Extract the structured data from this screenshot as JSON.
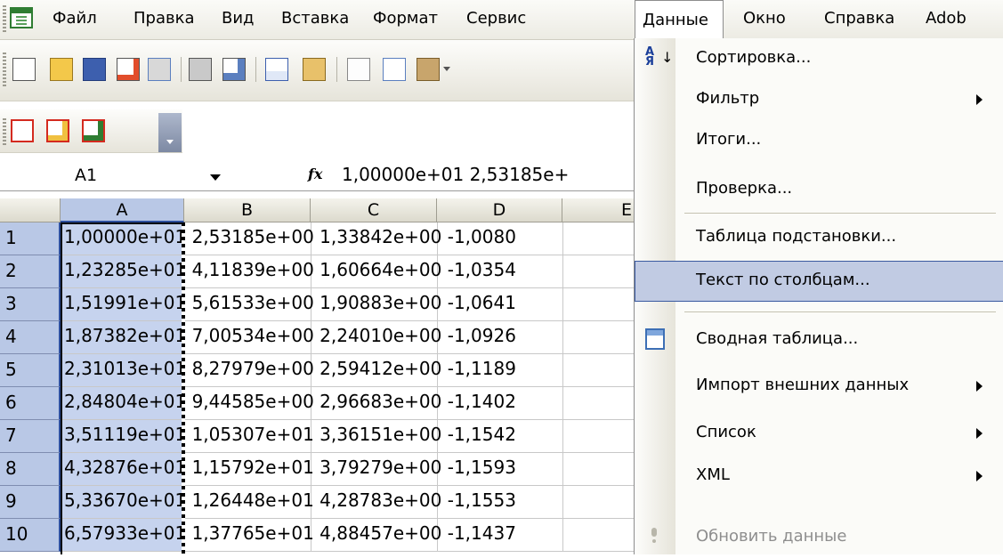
{
  "menubar": {
    "items": [
      {
        "label": "Файл"
      },
      {
        "label": "Правка"
      },
      {
        "label": "Вид"
      },
      {
        "label": "Вставка"
      },
      {
        "label": "Формат"
      },
      {
        "label": "Сервис"
      },
      {
        "label": "Данные"
      },
      {
        "label": "Окно"
      },
      {
        "label": "Справка"
      },
      {
        "label": "Adob"
      }
    ],
    "active_index": 6
  },
  "toolbar": {
    "icons": [
      "new-document-icon",
      "open-folder-icon",
      "save-icon",
      "permission-icon",
      "email-icon",
      "print-icon",
      "print-preview-icon",
      "spelling-icon",
      "research-icon",
      "cut-icon",
      "copy-icon",
      "paste-icon"
    ],
    "pdf_icons": [
      "convert-to-pdf-icon",
      "convert-and-email-pdf-icon",
      "convert-and-review-pdf-icon"
    ]
  },
  "formula_bar": {
    "name_box": "A1",
    "fx_label": "fx",
    "formula": "1,00000e+01  2,53185e+"
  },
  "sheet": {
    "columns": [
      "A",
      "B",
      "C",
      "D",
      "E"
    ],
    "rows": [
      {
        "num": "1",
        "text": "1,00000e+01  2,53185e+00  1,33842e+00 -1,0080"
      },
      {
        "num": "2",
        "text": "1,23285e+01  4,11839e+00  1,60664e+00 -1,0354"
      },
      {
        "num": "3",
        "text": "1,51991e+01  5,61533e+00  1,90883e+00 -1,0641"
      },
      {
        "num": "4",
        "text": "1,87382e+01  7,00534e+00  2,24010e+00 -1,0926"
      },
      {
        "num": "5",
        "text": "2,31013e+01  8,27979e+00  2,59412e+00 -1,1189"
      },
      {
        "num": "6",
        "text": "2,84804e+01  9,44585e+00  2,96683e+00 -1,1402"
      },
      {
        "num": "7",
        "text": "3,51119e+01  1,05307e+01  3,36151e+00 -1,1542"
      },
      {
        "num": "8",
        "text": "4,32876e+01  1,15792e+01  3,79279e+00 -1,1593"
      },
      {
        "num": "9",
        "text": "5,33670e+01  1,26448e+01  4,28783e+00 -1,1553"
      },
      {
        "num": "10",
        "text": "6,57933e+01  1,37765e+01  4,88457e+00 -1,1437"
      }
    ]
  },
  "data_menu": {
    "items": [
      {
        "label": "Сортировка...",
        "icon": "sort-ascending-icon",
        "submenu": false,
        "state": "normal"
      },
      {
        "label": "Фильтр",
        "submenu": true,
        "state": "normal"
      },
      {
        "label": "Итоги...",
        "submenu": false,
        "state": "normal"
      },
      {
        "label": "Проверка...",
        "submenu": false,
        "state": "normal"
      },
      {
        "label": "Таблица подстановки...",
        "submenu": false,
        "state": "normal"
      },
      {
        "label": "Текст по столбцам...",
        "submenu": false,
        "state": "highlighted"
      },
      {
        "label": "Сводная таблица...",
        "icon": "pivot-table-icon",
        "submenu": false,
        "state": "normal"
      },
      {
        "label": "Импорт внешних данных",
        "submenu": true,
        "state": "normal"
      },
      {
        "label": "Список",
        "submenu": true,
        "state": "normal"
      },
      {
        "label": "XML",
        "submenu": true,
        "state": "normal"
      },
      {
        "label": "Обновить данные",
        "icon": "refresh-data-icon",
        "submenu": false,
        "state": "disabled"
      }
    ]
  },
  "colors": {
    "selection_fill": "#c6d3ee",
    "header_selected": "#b9c8e6",
    "menu_highlight": "#c1cbe3",
    "menu_highlight_border": "#3a5aa0"
  }
}
